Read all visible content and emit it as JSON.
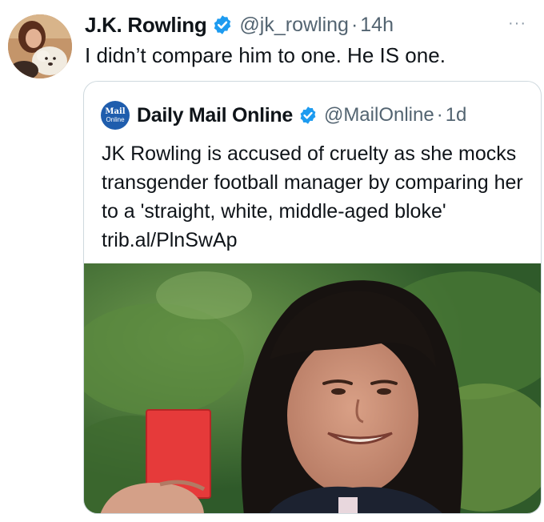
{
  "tweet": {
    "author_name": "J.K. Rowling",
    "handle": "@jk_rowling",
    "separator": "·",
    "time": "14h",
    "more_label": "···",
    "text": "I didn’t compare him to one. He IS one."
  },
  "quoted": {
    "avatar_line1": "Mail",
    "avatar_line2": "Online",
    "author_name": "Daily Mail Online",
    "handle": "@MailOnline",
    "separator": "·",
    "time": "1d",
    "text": "JK Rowling is accused of cruelty as she mocks transgender football manager by comparing her to a 'straight, white, middle-aged bloke' trib.al/PlnSwAp"
  },
  "icons": {
    "verified": "verified-badge-icon",
    "more": "more-horizontal-icon"
  },
  "colors": {
    "verified_blue": "#1d9bf0",
    "secondary_text": "#536471",
    "border": "#cfd9de",
    "mail_brand": "#1f5dad"
  }
}
